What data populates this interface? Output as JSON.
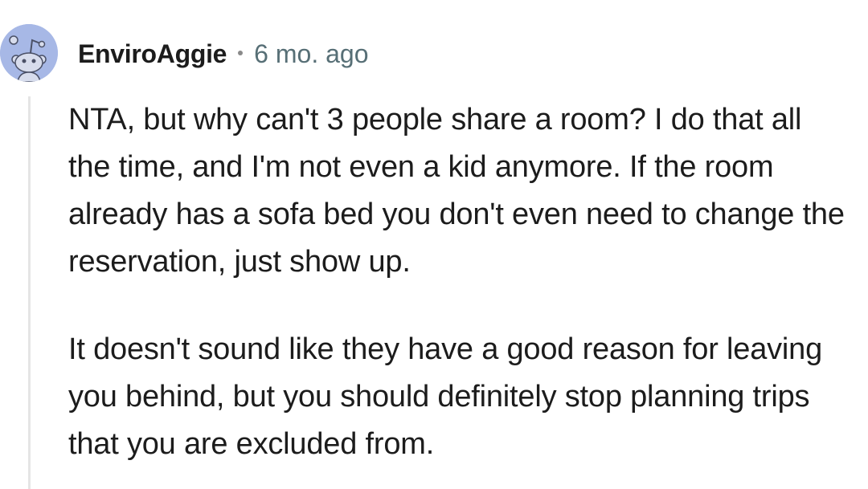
{
  "comment": {
    "author": "EnviroAggie",
    "separator": "•",
    "timestamp": "6 mo. ago",
    "avatar_icon": "snoo-avatar-icon",
    "avatar_color": "#a7b8e6",
    "paragraphs": [
      "NTA, but why can't 3 people share a room? I do that all the time, and I'm not even a kid anymore. If the room already has a sofa bed you don't even need to change the reservation, just show up.",
      "It doesn't sound like they have a good reason for leaving you behind, but you should definitely stop planning trips that you are excluded from."
    ]
  }
}
